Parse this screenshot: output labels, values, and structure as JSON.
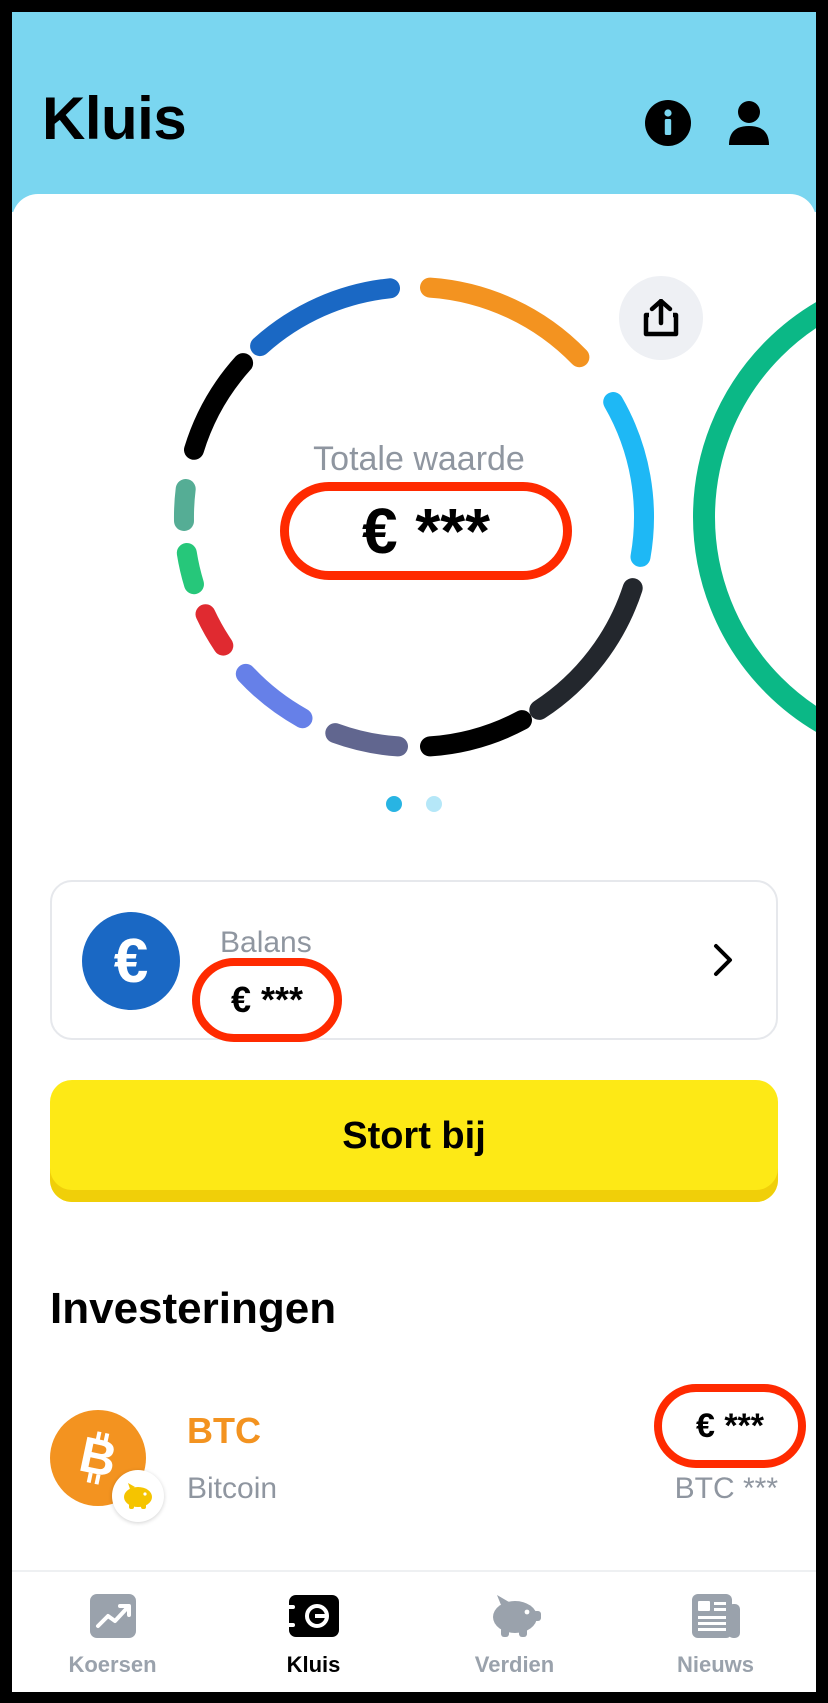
{
  "header": {
    "title": "Kluis"
  },
  "portfolio": {
    "total_label": "Totale waarde",
    "total_value": "€ ***",
    "ring_colors": [
      "#f39320",
      "#1eb8f5",
      "#23272d",
      "#000000",
      "#61668f",
      "#6680e8",
      "#e02a30",
      "#26c77a",
      "#55ad95",
      "#000000",
      "#1a68c4"
    ],
    "second_ring_color": "#0bb886",
    "page_index": "1 of 2"
  },
  "balance": {
    "label": "Balans",
    "value": "€ ***"
  },
  "deposit": {
    "label": "Stort bij"
  },
  "investments": {
    "title": "Investeringen",
    "items": [
      {
        "symbol": "BTC",
        "name": "Bitcoin",
        "value": "€ ***",
        "amount": "BTC ***",
        "symbol_color": "#f39320"
      }
    ]
  },
  "tabbar": {
    "tabs": [
      {
        "label": "Koersen",
        "icon": "chart-trend-icon",
        "active": false
      },
      {
        "label": "Kluis",
        "icon": "vault-icon",
        "active": true
      },
      {
        "label": "Verdien",
        "icon": "piggy-bank-icon",
        "active": false
      },
      {
        "label": "Nieuws",
        "icon": "newspaper-icon",
        "active": false
      }
    ]
  }
}
